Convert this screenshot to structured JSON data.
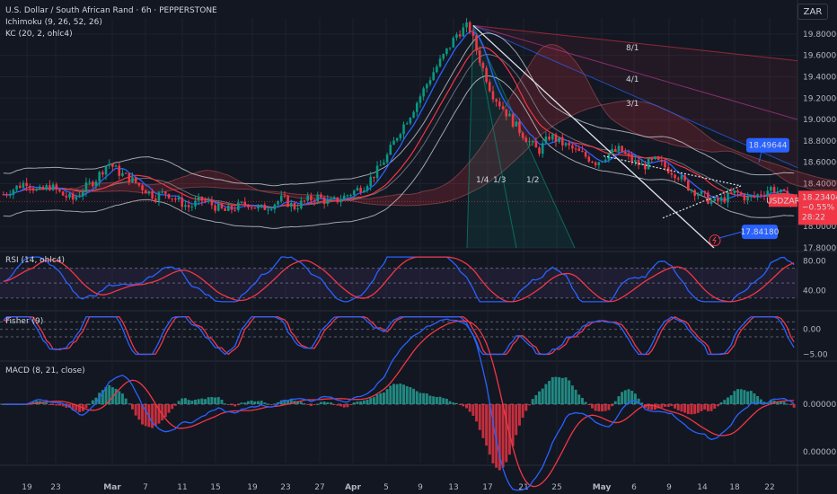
{
  "header": {
    "symbol_line": "U.S. Dollar / South African Rand · 6h · PEPPERSTONE",
    "ichimoku": "Ichimoku (9, 26, 52, 26)",
    "kc": "KC (20, 2, ohlc4)",
    "currency": "ZAR"
  },
  "colors": {
    "background": "#131722",
    "up": "#089981",
    "down": "#f23645",
    "conversion": "#2962ff",
    "base": "#f23645",
    "kc_band": "#d1d4dc",
    "price_tag": "#f23645",
    "blue_tag": "#2962ff"
  },
  "price_tag": {
    "symbol": "USDZAR",
    "price": "18.23404",
    "change": "−0.55%",
    "countdown": "28:22"
  },
  "annotations": {
    "upper_target": "18.49644",
    "lower_target": "17.84180"
  },
  "gann": {
    "fan_labels": [
      "1/4",
      "1/3",
      "1/2"
    ],
    "ray_labels": [
      "8/1",
      "4/1",
      "3/1"
    ]
  },
  "panes": {
    "rsi": {
      "title": "RSI (14, ohlc4)",
      "ticks": [
        "80.00",
        "40.00"
      ]
    },
    "fisher": {
      "title": "Fisher (9)",
      "ticks": [
        "0.00",
        "−5.00"
      ]
    },
    "macd": {
      "title": "MACD (8, 21, close)",
      "ticks": [
        "0.00000",
        "0.00000"
      ]
    }
  },
  "x_axis": {
    "labels": [
      "19",
      "23",
      "Mar",
      "7",
      "11",
      "15",
      "19",
      "23",
      "27",
      "Apr",
      "5",
      "9",
      "13",
      "17",
      "21",
      "25",
      "May",
      "6",
      "9",
      "14",
      "18",
      "22"
    ]
  },
  "chart_data": {
    "type": "candlestick",
    "price_scale": {
      "ticks": [
        "19.80000",
        "19.60000",
        "19.40000",
        "19.20000",
        "19.00000",
        "18.80000",
        "18.60000",
        "18.40000",
        "18.00000",
        "17.80000"
      ],
      "ylim": [
        17.8,
        19.95
      ]
    },
    "close_path": [
      18.3,
      18.36,
      18.42,
      18.32,
      18.38,
      18.3,
      18.25,
      18.36,
      18.45,
      18.6,
      18.5,
      18.44,
      18.36,
      18.28,
      18.32,
      18.24,
      18.18,
      18.25,
      18.2,
      18.14,
      18.18,
      18.22,
      18.16,
      18.2,
      18.26,
      18.18,
      18.24,
      18.28,
      18.22,
      18.26,
      18.32,
      18.38,
      18.5,
      18.66,
      18.88,
      19.05,
      19.25,
      19.45,
      19.62,
      19.8,
      19.88,
      19.55,
      19.25,
      19.1,
      18.95,
      18.82,
      18.7,
      18.85,
      18.78,
      18.72,
      18.66,
      18.6,
      18.68,
      18.72,
      18.62,
      18.56,
      18.62,
      18.55,
      18.48,
      18.36,
      18.3,
      18.22,
      18.26,
      18.32,
      18.26,
      18.3,
      18.36,
      18.3,
      18.23
    ],
    "rsi": {
      "ylim": [
        20,
        90
      ],
      "levels": [
        70,
        50,
        30
      ]
    },
    "fisher": {
      "ylim": [
        -6,
        3
      ],
      "levels": [
        1.5,
        0,
        -1.5
      ]
    },
    "macd": {
      "ylim": [
        -0.1,
        0.15
      ]
    }
  }
}
